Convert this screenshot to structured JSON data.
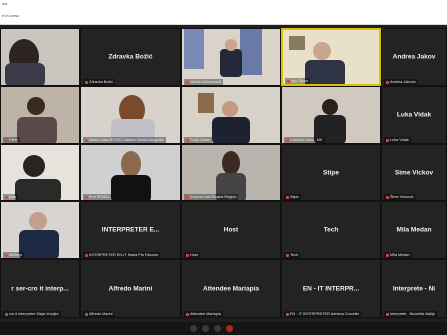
{
  "window": {
    "title": "ms",
    "subtitle": "e in corso"
  },
  "tiles": [
    {
      "row": 0,
      "col": 0,
      "type": "video",
      "label": ""
    },
    {
      "row": 0,
      "col": 1,
      "type": "name",
      "name": "Zdravka Božić",
      "label": "Zdravka Božić"
    },
    {
      "row": 0,
      "col": 2,
      "type": "video",
      "label": "Nikola Dobroslavić"
    },
    {
      "row": 0,
      "col": 3,
      "type": "video",
      "label": "ego Zippo",
      "active": true
    },
    {
      "row": 0,
      "col": 4,
      "type": "name",
      "name": "Andrea Jakov",
      "label": "Andrea Jakovic"
    },
    {
      "row": 1,
      "col": 0,
      "type": "video",
      "label": "Fehir"
    },
    {
      "row": 1,
      "col": 1,
      "type": "video",
      "label": "Maria Luisa ROSSI, Adriano Scola Zangolini"
    },
    {
      "row": 1,
      "col": 2,
      "type": "video",
      "label": "Frapi Orban"
    },
    {
      "row": 1,
      "col": 3,
      "type": "video",
      "label": "Carmela Urso - MK"
    },
    {
      "row": 1,
      "col": 4,
      "type": "name",
      "name": "Luka Vidak",
      "label": "Luka Vidak"
    },
    {
      "row": 2,
      "col": 0,
      "type": "video",
      "label": "luka"
    },
    {
      "row": 2,
      "col": 1,
      "type": "video",
      "label": "Erni SEMAL"
    },
    {
      "row": 2,
      "col": 2,
      "type": "video",
      "label": "Emjona Hali Ricana Region"
    },
    {
      "row": 2,
      "col": 3,
      "type": "name",
      "name": "Stipe",
      "label": "Stipe"
    },
    {
      "row": 2,
      "col": 4,
      "type": "name",
      "name": "Šime Vickov",
      "label": "Šime Vicković"
    },
    {
      "row": 3,
      "col": 0,
      "type": "video",
      "label": "Imiliano"
    },
    {
      "row": 3,
      "col": 1,
      "type": "name",
      "name": "INTERPRETER E...",
      "label": "INTERPRETER EN-IT Maria Pia Falcone"
    },
    {
      "row": 3,
      "col": 2,
      "type": "name",
      "name": "Host",
      "label": "Host"
    },
    {
      "row": 3,
      "col": 3,
      "type": "name",
      "name": "Tech",
      "label": "Tech"
    },
    {
      "row": 3,
      "col": 4,
      "type": "name",
      "name": "Mila Medan",
      "label": "Mila Medan"
    },
    {
      "row": 4,
      "col": 0,
      "type": "name",
      "name": "r ser-cro it interp...",
      "label": "cro it interpreter Maja Vranjko"
    },
    {
      "row": 4,
      "col": 1,
      "type": "name",
      "name": "Alfredo Marini",
      "label": "Alfredo Marini"
    },
    {
      "row": 4,
      "col": 2,
      "type": "name",
      "name": "Attendee Mariapia",
      "label": "Attendee Mariapia"
    },
    {
      "row": 4,
      "col": 3,
      "type": "name",
      "name": "EN - IT INTERPR...",
      "label": "EN - IT INTERPRETER Adriana Crocetto"
    },
    {
      "row": 4,
      "col": 4,
      "type": "name",
      "name": "Interprete - Ni",
      "label": "Interprete - Nicoletta Balija"
    }
  ]
}
